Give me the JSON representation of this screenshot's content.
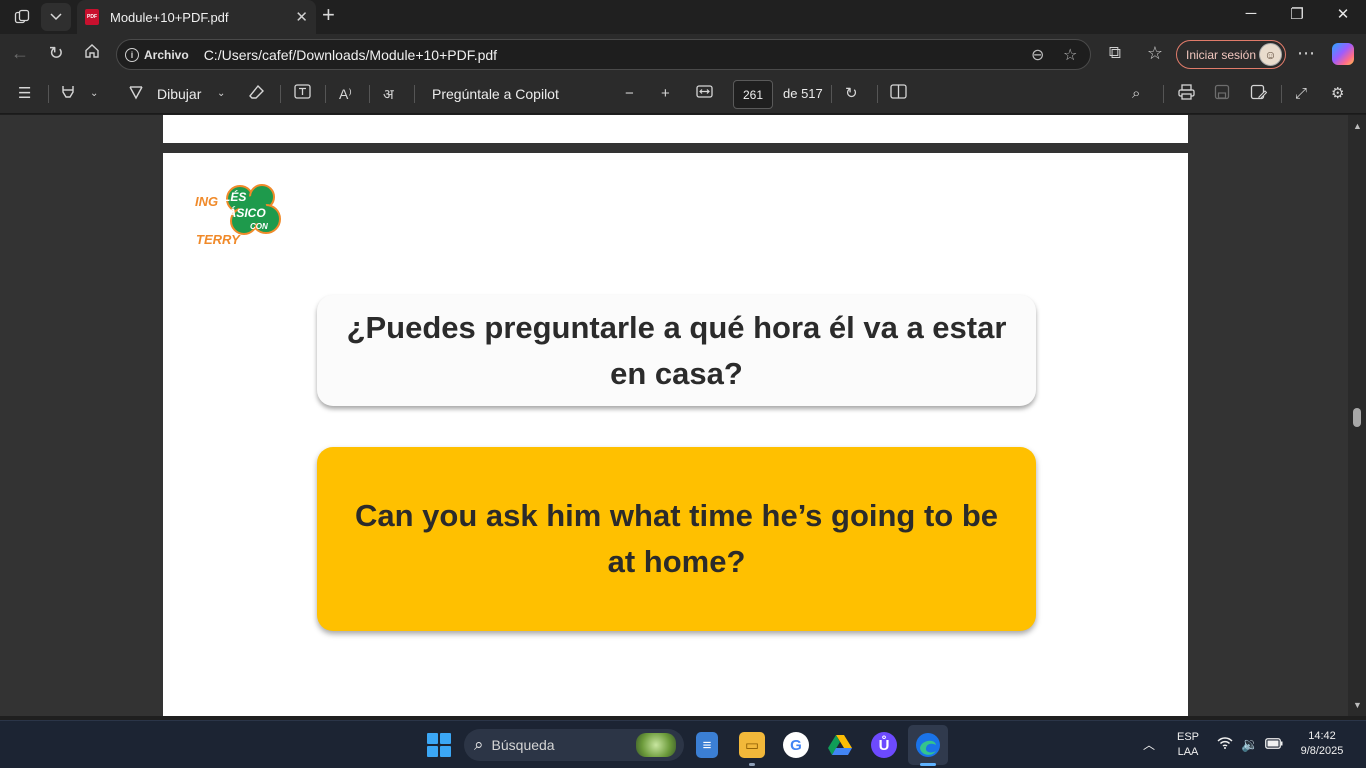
{
  "browser": {
    "tab": {
      "title": "Module+10+PDF.pdf",
      "favicon_label": "PDF"
    },
    "address": {
      "site_label": "Archivo",
      "url": "C:/Users/cafef/Downloads/Module+10+PDF.pdf"
    },
    "signin_label": "Iniciar sesión"
  },
  "pdf_toolbar": {
    "draw_label": "Dibujar",
    "copilot_label": "Pregúntale a Copilot",
    "page_current": "261",
    "page_total": "de 517"
  },
  "document": {
    "logo": {
      "ing": "ING",
      "les": "LÉS",
      "basico": "BÁSICO",
      "con": "CON",
      "terry": "TERRY"
    },
    "question_es": "¿Puedes preguntarle a qué hora él va a estar en casa?",
    "answer_en": "Can you ask him what time he’s going to be at home?"
  },
  "taskbar": {
    "search_label": "Búsqueda",
    "lang_top": "ESP",
    "lang_bottom": "LAA",
    "time": "14:42",
    "date": "9/8/2025"
  },
  "colors": {
    "answer_card": "#ffc000",
    "question_card": "#fbfbfb",
    "logo_green": "#1e9a4c",
    "logo_orange": "#f08a2a",
    "signin_border": "#e07b6a"
  },
  "icons": [
    "workspaces-icon",
    "tab-list-icon",
    "pdf-file-icon",
    "close-tab-icon",
    "new-tab-icon",
    "minimize-icon",
    "restore-icon",
    "close-window-icon",
    "back-icon",
    "refresh-icon",
    "home-icon",
    "info-icon",
    "zoom-out-icon",
    "favorite-star-icon",
    "extensions-icon",
    "favorites-icon",
    "profile-avatar-icon",
    "more-icon",
    "copilot-icon",
    "contents-icon",
    "highlight-icon",
    "draw-icon",
    "eraser-icon",
    "text-icon",
    "read-aloud-icon",
    "translate-icon",
    "minus-icon",
    "plus-icon",
    "fit-width-icon",
    "rotate-icon",
    "page-view-icon",
    "search-icon",
    "print-icon",
    "save-icon",
    "save-as-icon",
    "fullscreen-icon",
    "settings-icon",
    "windows-start-icon",
    "notepad-icon",
    "file-explorer-icon",
    "chrome-icon",
    "drive-icon",
    "proton-vpn-icon",
    "edge-icon",
    "chevron-up-icon",
    "wifi-icon",
    "volume-icon",
    "battery-icon"
  ]
}
